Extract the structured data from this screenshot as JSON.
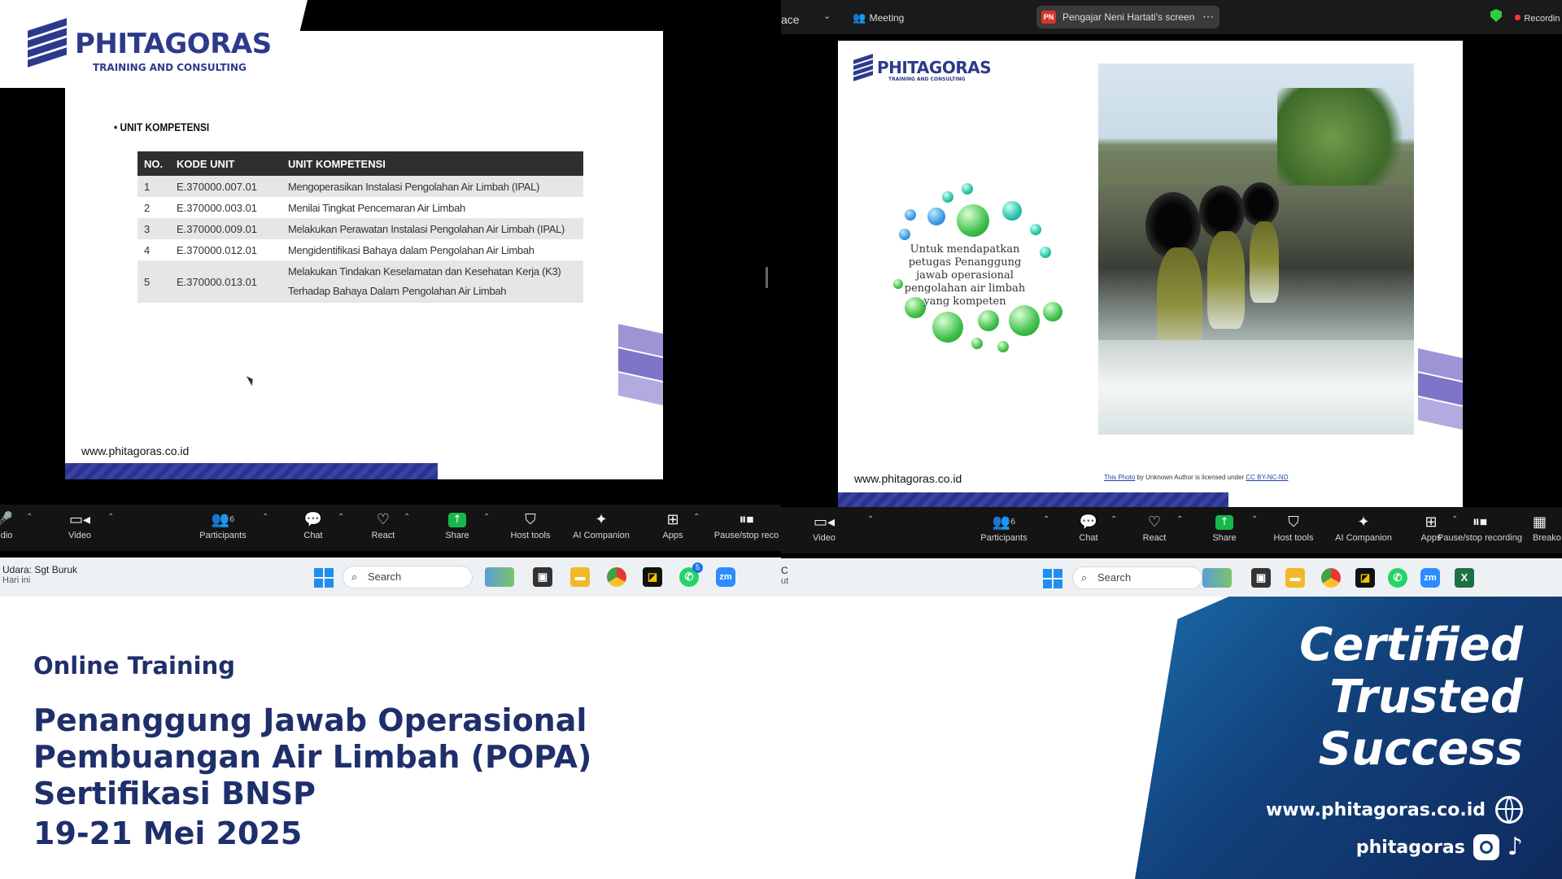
{
  "left": {
    "slide": {
      "logo_brand": "PHITAGORAS",
      "logo_sub": "TRAINING AND CONSULTING",
      "bullet_title": "UNIT KOMPETENSI",
      "table_headers": [
        "NO.",
        "KODE UNIT",
        "UNIT KOMPETENSI"
      ],
      "rows": [
        {
          "no": "1",
          "kode": "E.370000.007.01",
          "nama": "Mengoperasikan Instalasi Pengolahan Air Limbah (IPAL)"
        },
        {
          "no": "2",
          "kode": "E.370000.003.01",
          "nama": "Menilai Tingkat Pencemaran Air Limbah"
        },
        {
          "no": "3",
          "kode": "E.370000.009.01",
          "nama": "Melakukan Perawatan Instalasi Pengolahan Air Limbah (IPAL)"
        },
        {
          "no": "4",
          "kode": "E.370000.012.01",
          "nama": "Mengidentifikasi Bahaya dalam Pengolahan Air Limbah"
        },
        {
          "no": "5",
          "kode": "E.370000.013.01",
          "nama": "Melakukan Tindakan Keselamatan dan Kesehatan Kerja (K3) Terhadap Bahaya Dalam Pengolahan Air Limbah"
        }
      ],
      "url": "www.phitagoras.co.id"
    },
    "toolbar": {
      "audio": "udio",
      "video": "Video",
      "participants": "Participants",
      "participants_count": "6",
      "chat": "Chat",
      "react": "React",
      "share": "Share",
      "host_tools": "Host tools",
      "ai_companion": "AI Companion",
      "apps": "Apps",
      "pause_recording": "Pause/stop reco"
    },
    "taskbar": {
      "weather_line1": "Udara: Sgt Buruk",
      "weather_line2": "Hari ini",
      "search": "Search",
      "whatsapp_badge": "5"
    }
  },
  "right": {
    "topbar": {
      "left_text": "ace",
      "meeting": "Meeting",
      "screen_badge": "PN",
      "screen_label": "Pengajar Neni Hartati's screen",
      "recording": "Recordin"
    },
    "slide": {
      "logo_brand": "PHITAGORAS",
      "logo_sub": "TRAINING AND CONSULTING",
      "circle_text": "Untuk mendapatkan petugas Penanggung jawab operasional pengolahan air limbah yang kompeten",
      "credit_link": "This Photo",
      "credit_mid": " by Unknown Author is licensed under ",
      "credit_license": "CC BY-NC-ND",
      "url": "www.phitagoras.co.id"
    },
    "toolbar": {
      "video": "Video",
      "participants": "Participants",
      "participants_count": "6",
      "chat": "Chat",
      "react": "React",
      "share": "Share",
      "host_tools": "Host tools",
      "ai_companion": "AI Companion",
      "apps": "Apps",
      "pause_recording": "Pause/stop recording",
      "breakout": "Breako"
    },
    "taskbar": {
      "weather_line1": "C",
      "weather_line2": "ut",
      "search": "Search"
    }
  },
  "banner": {
    "subtitle": "Online Training",
    "title_line1": "Penanggung Jawab Operasional",
    "title_line2": "Pembuangan Air Limbah (POPA)",
    "title_line3": "Sertifikasi BNSP",
    "date": "19-21 Mei 2025",
    "slogan1": "Certified",
    "slogan2": "Trusted",
    "slogan3": "Success",
    "website": "www.phitagoras.co.id",
    "social": "phitagoras"
  },
  "colors": {
    "brand_navy": "#2d3a8c",
    "banner_text": "#1f2f6b",
    "panel_blue": "#12407a",
    "zoom_share_green": "#17b84a"
  }
}
